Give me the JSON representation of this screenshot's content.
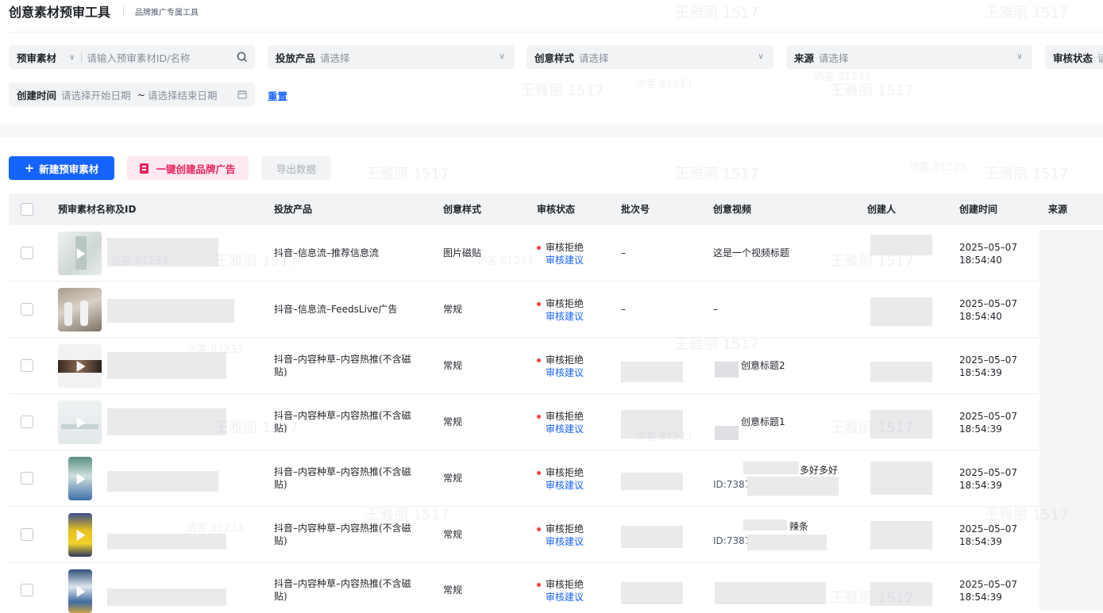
{
  "header": {
    "title": "创意素材预审工具",
    "subtitle": "品牌推广专属工具"
  },
  "filters": {
    "material": {
      "label": "预审素材",
      "placeholder": "请输入预审素材ID/名称"
    },
    "product": {
      "label": "投放产品",
      "placeholder": "请选择"
    },
    "style": {
      "label": "创意样式",
      "placeholder": "请选择"
    },
    "source": {
      "label": "来源",
      "placeholder": "请选择"
    },
    "review": {
      "label": "审核状态",
      "placeholder": "请"
    },
    "created": {
      "label": "创建时间",
      "start": "请选择开始日期",
      "tilde": "~",
      "end": "请选择结束日期"
    },
    "reset": "重置"
  },
  "toolbar": {
    "plus": "+",
    "new_label": "新建预审素材",
    "brand_label": "一键创建品牌广告",
    "export_label": "导出数据"
  },
  "table": {
    "columns": [
      "预审素材名称及ID",
      "投放产品",
      "创意样式",
      "审核状态",
      "批次号",
      "创意视频",
      "创建人",
      "创建时间",
      "来源"
    ],
    "rows": [
      {
        "product": "抖音–信息流–推荐信息流",
        "style": "图片磁贴",
        "status": "审核拒绝",
        "suggest": "审核建议",
        "batch": "–",
        "video": "这是一个视频标题",
        "video_id": "",
        "date": "2025–05–07",
        "time": "18:54:40"
      },
      {
        "product": "抖音–信息流–FeedsLive广告",
        "style": "常规",
        "status": "审核拒绝",
        "suggest": "审核建议",
        "batch": "–",
        "video": "–",
        "video_id": "",
        "date": "2025–05–07",
        "time": "18:54:40"
      },
      {
        "product": "抖音–内容种草–内容热推(不含磁贴)",
        "style": "常规",
        "status": "审核拒绝",
        "suggest": "审核建议",
        "batch": "",
        "video": "创意标题2",
        "video_id": "",
        "date": "2025–05–07",
        "time": "18:54:39"
      },
      {
        "product": "抖音–内容种草–内容热推(不含磁贴)",
        "style": "常规",
        "status": "审核拒绝",
        "suggest": "审核建议",
        "batch": "",
        "video": "创意标题1",
        "video_id": "",
        "date": "2025–05–07",
        "time": "18:54:39"
      },
      {
        "product": "抖音–内容种草–内容热推(不含磁贴)",
        "style": "常规",
        "status": "审核拒绝",
        "suggest": "审核建议",
        "batch": "",
        "video": "多好多好",
        "video_id": "ID:7387",
        "date": "2025–05–07",
        "time": "18:54:39"
      },
      {
        "product": "抖音–内容种草–内容热推(不含磁贴)",
        "style": "常规",
        "status": "审核拒绝",
        "suggest": "审核建议",
        "batch": "",
        "video": "辣条",
        "video_id": "ID:7387",
        "date": "2025–05–07",
        "time": "18:54:39"
      },
      {
        "product": "抖音–内容种草–内容热推(不含磁贴)",
        "style": "常规",
        "status": "审核拒绝",
        "suggest": "审核建议",
        "batch": "",
        "video": "",
        "video_id": "",
        "date": "2025–05–07",
        "time": "18:54:39"
      }
    ]
  },
  "watermarks": [
    "王雅丽 1517",
    "访客 81233"
  ],
  "colors": {
    "primary": "#1664ff",
    "danger": "#f53f3f",
    "pink": "#e8245c",
    "pink_bg": "#ffe8ef"
  },
  "icons": {
    "search": "search-icon",
    "chevron": "chevron-down-icon",
    "calendar": "calendar-icon",
    "play": "play-icon",
    "bookmark": "bookmark-icon"
  }
}
